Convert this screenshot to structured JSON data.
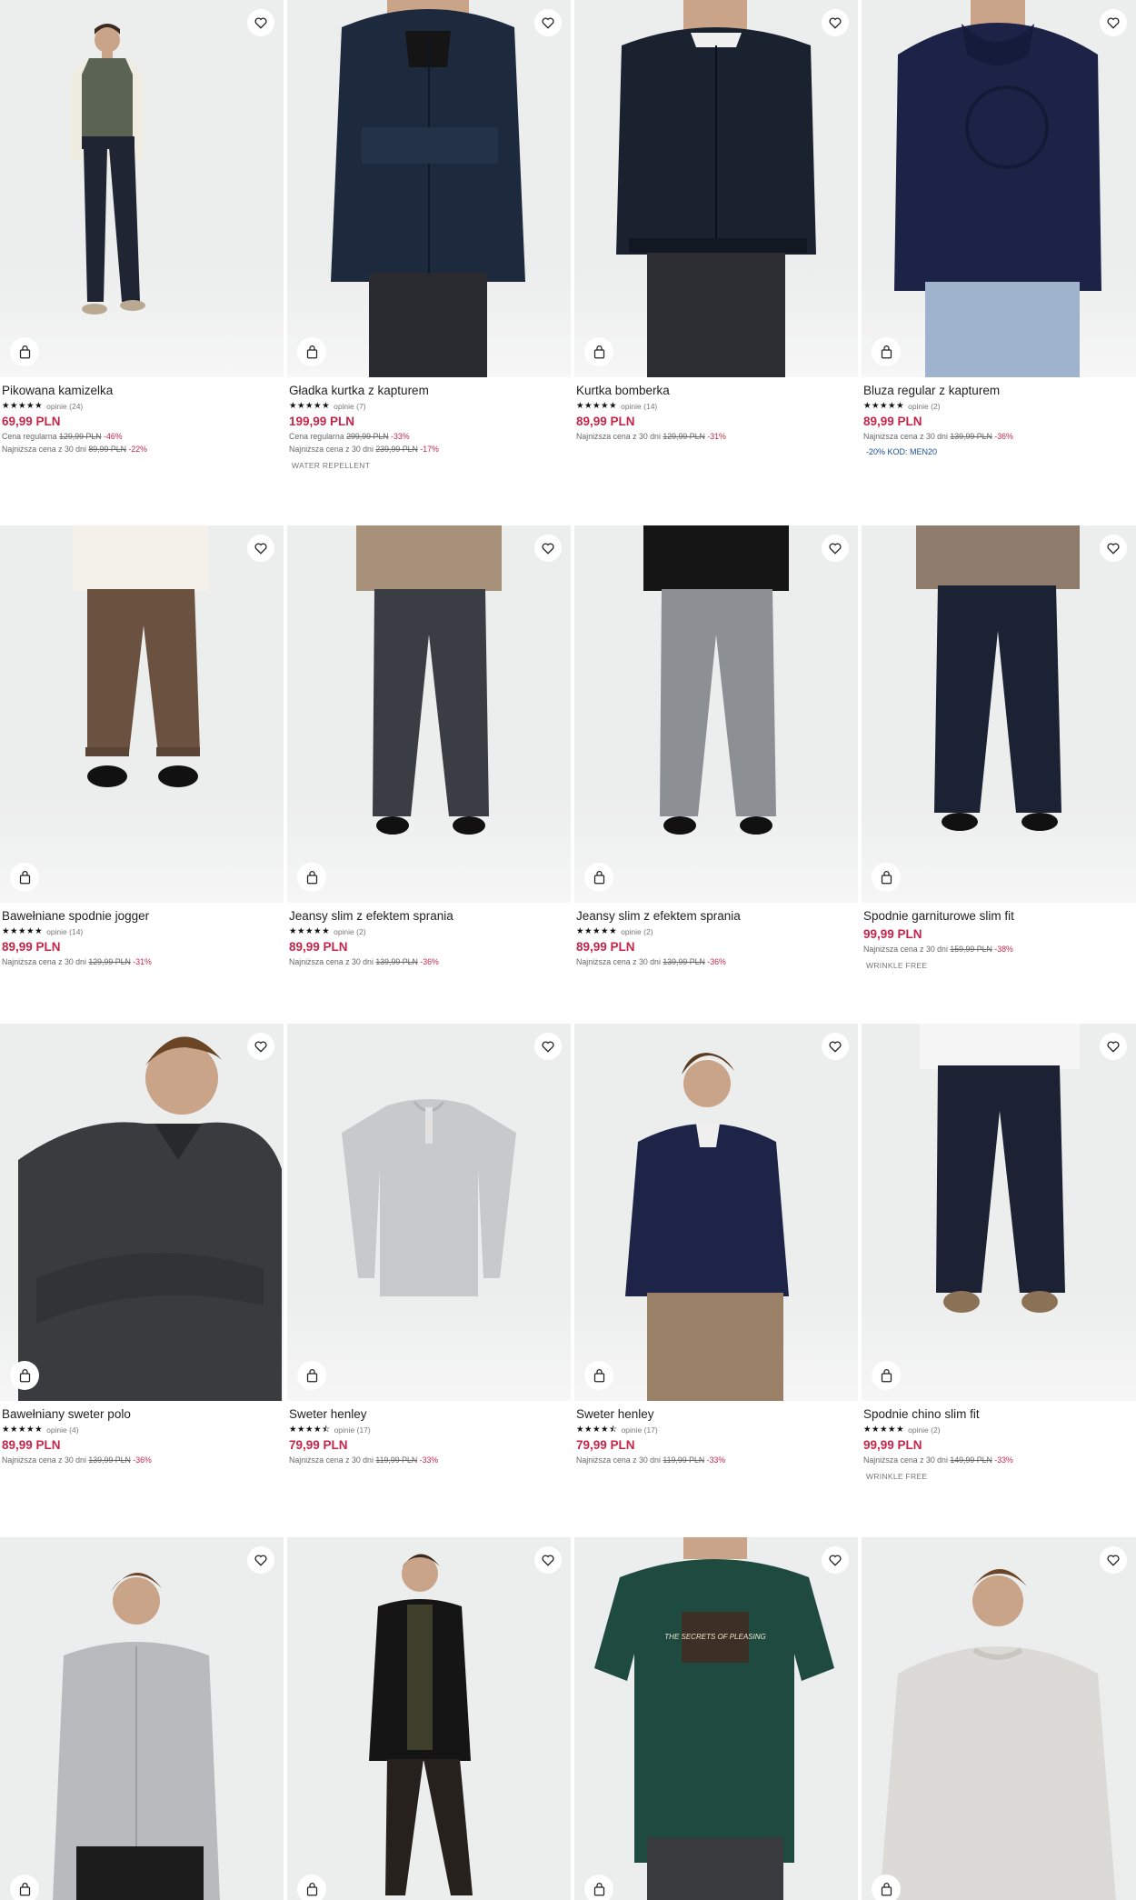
{
  "icons": {
    "favorite": "heart-icon",
    "cart": "shopping-bag-icon",
    "star": "star-icon"
  },
  "colors": {
    "price": "#c4264a",
    "promo": "#1c4e96"
  },
  "products": [
    {
      "name": "Pikowana kamizelka",
      "stars": "★★★★★",
      "reviews": "opinie (24)",
      "price": "69,99 PLN",
      "regular_label": "Cena regularna",
      "regular_old": "129,99 PLN",
      "regular_pct": "-46%",
      "lowest_label": "Najniższa cena z 30 dni",
      "lowest_old": "89,99 PLN",
      "lowest_pct": "-22%"
    },
    {
      "name": "Gładka kurtka z kapturem",
      "stars": "★★★★★",
      "reviews": "opinie (7)",
      "price": "199,99 PLN",
      "regular_label": "Cena regularna",
      "regular_old": "299,99 PLN",
      "regular_pct": "-33%",
      "lowest_label": "Najniższa cena z 30 dni",
      "lowest_old": "239,99 PLN",
      "lowest_pct": "-17%",
      "tag": "WATER REPELLENT"
    },
    {
      "name": "Kurtka bomberka",
      "stars": "★★★★★",
      "reviews": "opinie (14)",
      "price": "89,99 PLN",
      "lowest_label": "Najniższa cena z 30 dni",
      "lowest_old": "129,99 PLN",
      "lowest_pct": "-31%"
    },
    {
      "name": "Bluza regular z kapturem",
      "stars": "★★★★★",
      "reviews": "opinie (2)",
      "price": "89,99 PLN",
      "lowest_label": "Najniższa cena z 30 dni",
      "lowest_old": "139,99 PLN",
      "lowest_pct": "-36%",
      "promo": "-20% KOD: MEN20"
    },
    {
      "name": "Bawełniane spodnie jogger",
      "stars": "★★★★★",
      "reviews": "opinie (14)",
      "price": "89,99 PLN",
      "lowest_label": "Najniższa cena z 30 dni",
      "lowest_old": "129,99 PLN",
      "lowest_pct": "-31%"
    },
    {
      "name": "Jeansy slim z efektem sprania",
      "stars": "★★★★★",
      "reviews": "opinie (2)",
      "price": "89,99 PLN",
      "lowest_label": "Najniższa cena z 30 dni",
      "lowest_old": "139,99 PLN",
      "lowest_pct": "-36%"
    },
    {
      "name": "Jeansy slim z efektem sprania",
      "stars": "★★★★★",
      "reviews": "opinie (2)",
      "price": "89,99 PLN",
      "lowest_label": "Najniższa cena z 30 dni",
      "lowest_old": "139,99 PLN",
      "lowest_pct": "-36%"
    },
    {
      "name": "Spodnie garniturowe slim fit",
      "price": "99,99 PLN",
      "lowest_label": "Najniższa cena z 30 dni",
      "lowest_old": "159,99 PLN",
      "lowest_pct": "-38%",
      "tag": "WRINKLE FREE"
    },
    {
      "name": "Bawełniany sweter polo",
      "stars": "★★★★★",
      "reviews": "opinie (4)",
      "price": "89,99 PLN",
      "lowest_label": "Najniższa cena z 30 dni",
      "lowest_old": "139,99 PLN",
      "lowest_pct": "-36%"
    },
    {
      "name": "Sweter henley",
      "stars": "★★★★⯪",
      "reviews": "opinie (17)",
      "price": "79,99 PLN",
      "lowest_label": "Najniższa cena z 30 dni",
      "lowest_old": "119,99 PLN",
      "lowest_pct": "-33%"
    },
    {
      "name": "Sweter henley",
      "stars": "★★★★⯪",
      "reviews": "opinie (17)",
      "price": "79,99 PLN",
      "lowest_label": "Najniższa cena z 30 dni",
      "lowest_old": "119,99 PLN",
      "lowest_pct": "-33%"
    },
    {
      "name": "Spodnie chino slim fit",
      "stars": "★★★★★",
      "reviews": "opinie (2)",
      "price": "99,99 PLN",
      "lowest_label": "Najniższa cena z 30 dni",
      "lowest_old": "149,99 PLN",
      "lowest_pct": "-33%",
      "tag": "WRINKLE FREE"
    },
    {
      "name": ""
    },
    {
      "name": ""
    },
    {
      "name": ""
    },
    {
      "name": ""
    }
  ],
  "graphic_text": {
    "tshirt_print": "THE SECRETS OF PLEASING"
  }
}
